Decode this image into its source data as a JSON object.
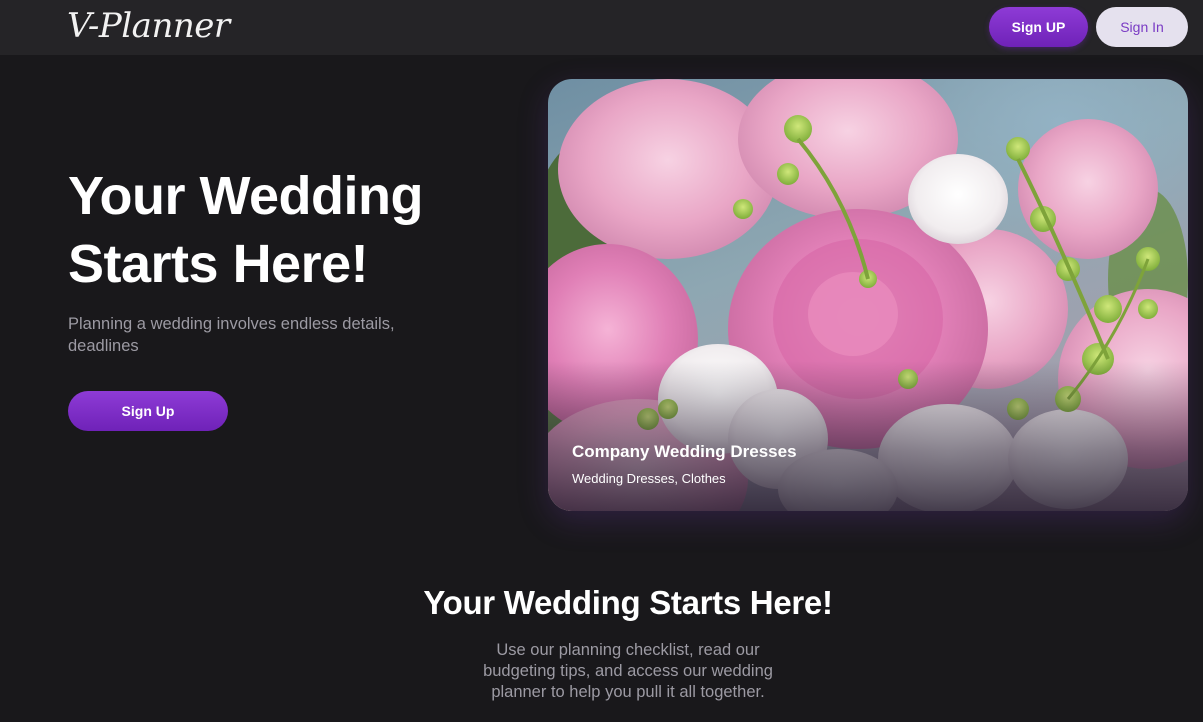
{
  "header": {
    "logo_text": "V-Planner",
    "signup_label": "Sign UP",
    "signin_label": "Sign In"
  },
  "hero": {
    "title": "Your Wedding Starts Here!",
    "subtitle": "Planning a wedding involves endless details, deadlines",
    "signup_label": "Sign Up"
  },
  "card": {
    "title": "Company Wedding Dresses",
    "tags": "Wedding Dresses, Clothes",
    "image": "pink-peony-bouquet"
  },
  "section": {
    "title": "Your Wedding Starts Here!",
    "text": "Use our planning checklist, read our budgeting tips, and access our wedding planner to help you pull it all together."
  },
  "colors": {
    "page_bg": "#19181b",
    "header_bg": "#252427",
    "accent_purple": "#7d2fc8",
    "signin_bg": "#e5e1ee",
    "muted_text": "#9c9aa3"
  }
}
